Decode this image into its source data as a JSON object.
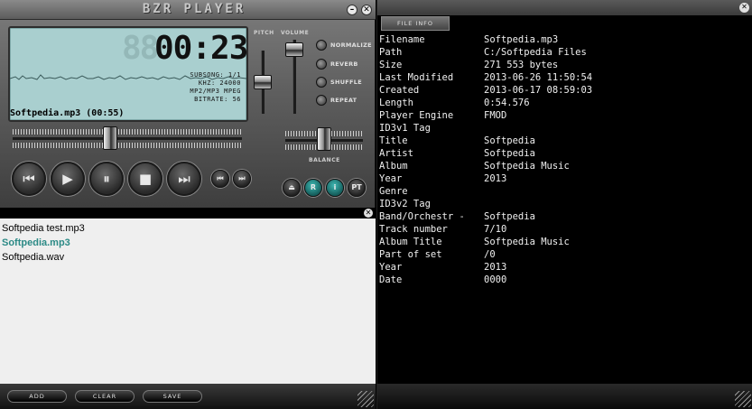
{
  "player": {
    "title": "BZR PLAYER",
    "minimize_label": "–",
    "close_label": "✕",
    "lcd": {
      "time_ghost": "88",
      "time": "00:23",
      "subsong": "SUBSONG: 1/1",
      "khz": "KHZ: 24000",
      "format": "MP2/MP3 MPEG",
      "bitrate": "BITRATE: 56",
      "track": "Softpedia.mp3  (00:55)"
    },
    "labels": {
      "pitch": "PITCH",
      "volume": "VOLUME",
      "balance": "BALANCE"
    },
    "options": [
      "NORMALIZE",
      "REVERB",
      "SHUFFLE",
      "REPEAT"
    ],
    "transport": {
      "prev": "⏮",
      "play": "▶",
      "pause": "⏸",
      "stop": "■",
      "next": "⏭",
      "small_prev": "⏮",
      "small_next": "⏭"
    },
    "small_buttons": {
      "eject": "⏏",
      "r": "R",
      "i": "i",
      "pt": "PT"
    },
    "levels": {
      "pitch": 0.5,
      "volume": 0.95,
      "balance": 0.5,
      "seek": 0.42
    }
  },
  "playlist": {
    "close_label": "✕",
    "items": [
      {
        "name": "Softpedia test.mp3",
        "active": false
      },
      {
        "name": "Softpedia.mp3",
        "active": true
      },
      {
        "name": "Softpedia.wav",
        "active": false
      }
    ],
    "buttons": {
      "add": "ADD",
      "clear": "CLEAR",
      "save": "SAVE"
    }
  },
  "fileinfo": {
    "tab": "FILE INFO",
    "close_label": "✕",
    "rows": [
      {
        "k": "Filename",
        "v": "Softpedia.mp3"
      },
      {
        "k": "Path",
        "v": "C:/Softpedia Files"
      },
      {
        "k": "Size",
        "v": "271 553 bytes"
      },
      {
        "k": "Last Modified",
        "v": "2013-06-26 11:50:54"
      },
      {
        "k": "Created",
        "v": "2013-06-17 08:59:03"
      },
      {
        "k": "Length",
        "v": "0:54.576"
      },
      {
        "k": "Player Engine",
        "v": "FMOD"
      },
      {
        "k": "ID3v1 Tag",
        "v": ""
      },
      {
        "k": "Title",
        "v": "Softpedia"
      },
      {
        "k": "Artist",
        "v": "Softpedia"
      },
      {
        "k": "Album",
        "v": "Softpedia Music"
      },
      {
        "k": "Year",
        "v": "2013"
      },
      {
        "k": "Genre",
        "v": ""
      },
      {
        "k": "ID3v2 Tag",
        "v": ""
      },
      {
        "k": "Band/Orchestr -",
        "v": "Softpedia"
      },
      {
        "k": "Track number",
        "v": "7/10"
      },
      {
        "k": "Album Title",
        "v": "Softpedia Music"
      },
      {
        "k": "Part of set",
        "v": "/0"
      },
      {
        "k": "Year",
        "v": "2013"
      },
      {
        "k": "Date",
        "v": "0000"
      }
    ]
  }
}
